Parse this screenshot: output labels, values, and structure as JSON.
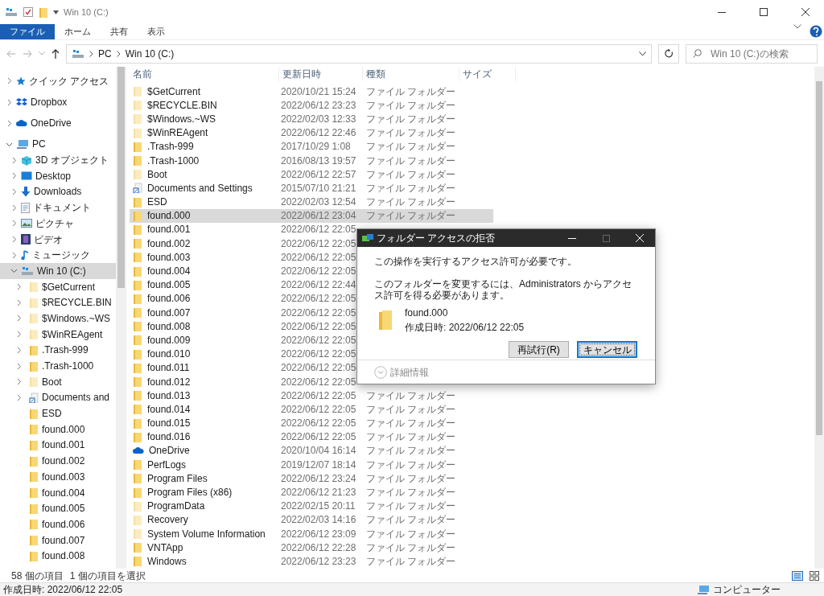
{
  "window": {
    "title": "Win 10 (C:)"
  },
  "ribbon_tabs": [
    {
      "label": "ファイル",
      "selected": true
    },
    {
      "label": "ホーム",
      "selected": false
    },
    {
      "label": "共有",
      "selected": false
    },
    {
      "label": "表示",
      "selected": false
    }
  ],
  "address_bar": {
    "path": [
      "PC",
      "Win 10 (C:)"
    ]
  },
  "search": {
    "placeholder": "Win 10 (C:)の検索"
  },
  "sidebar": {
    "items": [
      {
        "label": "クイック アクセス",
        "kind": "star",
        "expanded": false,
        "selected": false
      },
      {
        "label": "Dropbox",
        "kind": "dropbox",
        "expanded": false,
        "selected": false
      },
      {
        "label": "OneDrive",
        "kind": "cloud",
        "expanded": false,
        "selected": false
      },
      {
        "label": "PC",
        "kind": "pc",
        "expanded": true,
        "selected": false,
        "children": [
          {
            "label": "3D オブジェクト",
            "kind": "cube",
            "expanded": false,
            "selected": false
          },
          {
            "label": "Desktop",
            "kind": "desktop",
            "expanded": false,
            "selected": false
          },
          {
            "label": "Downloads",
            "kind": "download",
            "expanded": false,
            "selected": false
          },
          {
            "label": "ドキュメント",
            "kind": "document",
            "expanded": false,
            "selected": false
          },
          {
            "label": "ピクチャ",
            "kind": "picture",
            "expanded": false,
            "selected": false
          },
          {
            "label": "ビデオ",
            "kind": "video",
            "expanded": false,
            "selected": false
          },
          {
            "label": "ミュージック",
            "kind": "music",
            "expanded": false,
            "selected": false
          },
          {
            "label": "Win 10 (C:)",
            "kind": "drive",
            "expanded": true,
            "selected": true,
            "children": [
              {
                "label": "$GetCurrent",
                "kind": "folder",
                "hidden": true,
                "expanded": false,
                "selected": false
              },
              {
                "label": "$RECYCLE.BIN",
                "kind": "folder",
                "hidden": true,
                "expanded": false,
                "selected": false
              },
              {
                "label": "$Windows.~WS",
                "kind": "folder",
                "hidden": true,
                "expanded": false,
                "selected": false
              },
              {
                "label": "$WinREAgent",
                "kind": "folder",
                "hidden": true,
                "expanded": false,
                "selected": false
              },
              {
                "label": ".Trash-999",
                "kind": "folder",
                "hidden": false,
                "expanded": false,
                "selected": false
              },
              {
                "label": ".Trash-1000",
                "kind": "folder",
                "hidden": false,
                "expanded": false,
                "selected": false
              },
              {
                "label": "Boot",
                "kind": "folder",
                "hidden": true,
                "expanded": false,
                "selected": false
              },
              {
                "label": "Documents and",
                "kind": "shortcut",
                "hidden": false,
                "expanded": false,
                "selected": false
              },
              {
                "label": "ESD",
                "kind": "folder",
                "hidden": false,
                "selected": false
              },
              {
                "label": "found.000",
                "kind": "folder",
                "hidden": false,
                "selected": false
              },
              {
                "label": "found.001",
                "kind": "folder",
                "hidden": false,
                "selected": false
              },
              {
                "label": "found.002",
                "kind": "folder",
                "hidden": false,
                "selected": false
              },
              {
                "label": "found.003",
                "kind": "folder",
                "hidden": false,
                "selected": false
              },
              {
                "label": "found.004",
                "kind": "folder",
                "hidden": false,
                "selected": false
              },
              {
                "label": "found.005",
                "kind": "folder",
                "hidden": false,
                "selected": false
              },
              {
                "label": "found.006",
                "kind": "folder",
                "hidden": false,
                "selected": false
              },
              {
                "label": "found.007",
                "kind": "folder",
                "hidden": false,
                "selected": false
              },
              {
                "label": "found.008",
                "kind": "folder",
                "hidden": false,
                "selected": false
              }
            ]
          }
        ]
      }
    ]
  },
  "file_list": {
    "columns": [
      "名前",
      "更新日時",
      "種類",
      "サイズ"
    ],
    "rows": [
      {
        "name": "$GetCurrent",
        "date": "2020/10/21 15:24",
        "type": "ファイル フォルダー",
        "kind": "folder",
        "hidden": true,
        "selected": false
      },
      {
        "name": "$RECYCLE.BIN",
        "date": "2022/06/12 23:23",
        "type": "ファイル フォルダー",
        "kind": "folder",
        "hidden": true,
        "selected": false
      },
      {
        "name": "$Windows.~WS",
        "date": "2022/02/03 12:33",
        "type": "ファイル フォルダー",
        "kind": "folder",
        "hidden": true,
        "selected": false
      },
      {
        "name": "$WinREAgent",
        "date": "2022/06/12 22:46",
        "type": "ファイル フォルダー",
        "kind": "folder",
        "hidden": true,
        "selected": false
      },
      {
        "name": ".Trash-999",
        "date": "2017/10/29 1:08",
        "type": "ファイル フォルダー",
        "kind": "folder",
        "hidden": false,
        "selected": false
      },
      {
        "name": ".Trash-1000",
        "date": "2016/08/13 19:57",
        "type": "ファイル フォルダー",
        "kind": "folder",
        "hidden": false,
        "selected": false
      },
      {
        "name": "Boot",
        "date": "2022/06/12 22:57",
        "type": "ファイル フォルダー",
        "kind": "folder",
        "hidden": true,
        "selected": false
      },
      {
        "name": "Documents and Settings",
        "date": "2015/07/10 21:21",
        "type": "ファイル フォルダー",
        "kind": "shortcut",
        "hidden": false,
        "selected": false
      },
      {
        "name": "ESD",
        "date": "2022/02/03 12:54",
        "type": "ファイル フォルダー",
        "kind": "folder",
        "hidden": false,
        "selected": false
      },
      {
        "name": "found.000",
        "date": "2022/06/12 23:04",
        "type": "ファイル フォルダー",
        "kind": "folder",
        "hidden": false,
        "selected": true
      },
      {
        "name": "found.001",
        "date": "2022/06/12 22:05",
        "kind": "folder",
        "hidden": false,
        "selected": false
      },
      {
        "name": "found.002",
        "date": "2022/06/12 22:05",
        "kind": "folder",
        "hidden": false,
        "selected": false
      },
      {
        "name": "found.003",
        "date": "2022/06/12 22:05",
        "kind": "folder",
        "hidden": false,
        "selected": false
      },
      {
        "name": "found.004",
        "date": "2022/06/12 22:05",
        "kind": "folder",
        "hidden": false,
        "selected": false
      },
      {
        "name": "found.005",
        "date": "2022/06/12 22:44",
        "kind": "folder",
        "hidden": false,
        "selected": false
      },
      {
        "name": "found.006",
        "date": "2022/06/12 22:05",
        "kind": "folder",
        "hidden": false,
        "selected": false
      },
      {
        "name": "found.007",
        "date": "2022/06/12 22:05",
        "kind": "folder",
        "hidden": false,
        "selected": false
      },
      {
        "name": "found.008",
        "date": "2022/06/12 22:05",
        "kind": "folder",
        "hidden": false,
        "selected": false
      },
      {
        "name": "found.009",
        "date": "2022/06/12 22:05",
        "kind": "folder",
        "hidden": false,
        "selected": false
      },
      {
        "name": "found.010",
        "date": "2022/06/12 22:05",
        "kind": "folder",
        "hidden": false,
        "selected": false
      },
      {
        "name": "found.011",
        "date": "2022/06/12 22:05",
        "kind": "folder",
        "hidden": false,
        "selected": false
      },
      {
        "name": "found.012",
        "date": "2022/06/12 22:05",
        "kind": "folder",
        "hidden": false,
        "selected": false
      },
      {
        "name": "found.013",
        "date": "2022/06/12 22:05",
        "type": "ファイル フォルダー",
        "kind": "folder",
        "hidden": false,
        "selected": false
      },
      {
        "name": "found.014",
        "date": "2022/06/12 22:05",
        "type": "ファイル フォルダー",
        "kind": "folder",
        "hidden": false,
        "selected": false
      },
      {
        "name": "found.015",
        "date": "2022/06/12 22:05",
        "type": "ファイル フォルダー",
        "kind": "folder",
        "hidden": false,
        "selected": false
      },
      {
        "name": "found.016",
        "date": "2022/06/12 22:05",
        "type": "ファイル フォルダー",
        "kind": "folder",
        "hidden": false,
        "selected": false
      },
      {
        "name": "OneDrive",
        "date": "2020/10/04 16:14",
        "type": "ファイル フォルダー",
        "kind": "cloud",
        "hidden": false,
        "selected": false
      },
      {
        "name": "PerfLogs",
        "date": "2019/12/07 18:14",
        "type": "ファイル フォルダー",
        "kind": "folder",
        "hidden": false,
        "selected": false
      },
      {
        "name": "Program Files",
        "date": "2022/06/12 23:24",
        "type": "ファイル フォルダー",
        "kind": "folder",
        "hidden": false,
        "selected": false
      },
      {
        "name": "Program Files (x86)",
        "date": "2022/06/12 21:23",
        "type": "ファイル フォルダー",
        "kind": "folder",
        "hidden": false,
        "selected": false
      },
      {
        "name": "ProgramData",
        "date": "2022/02/15 20:11",
        "type": "ファイル フォルダー",
        "kind": "folder",
        "hidden": true,
        "selected": false
      },
      {
        "name": "Recovery",
        "date": "2022/02/03 14:16",
        "type": "ファイル フォルダー",
        "kind": "folder",
        "hidden": true,
        "selected": false
      },
      {
        "name": "System Volume Information",
        "date": "2022/06/12 23:09",
        "type": "ファイル フォルダー",
        "kind": "folder",
        "hidden": true,
        "selected": false
      },
      {
        "name": "VNTApp",
        "date": "2022/06/12 22:28",
        "type": "ファイル フォルダー",
        "kind": "folder",
        "hidden": false,
        "selected": false
      },
      {
        "name": "Windows",
        "date": "2022/06/12 23:23",
        "type": "ファイル フォルダー",
        "kind": "folder",
        "hidden": false,
        "selected": false
      }
    ]
  },
  "status_bar": {
    "item_count": "58 個の項目",
    "selection": "1 個の項目を選択"
  },
  "details_bar": {
    "created": "作成日時: 2022/06/12 22:05",
    "location": "コンピューター"
  },
  "dialog": {
    "title": "フォルダー アクセスの拒否",
    "message": "この操作を実行するアクセス許可が必要です。",
    "detail": "このフォルダーを変更するには、Administrators からアクセス許可を得る必要があります。",
    "item_name": "found.000",
    "item_created": "作成日時: 2022/06/12 22:05",
    "buttons": [
      {
        "label": "再試行(R)",
        "focused": false
      },
      {
        "label": "キャンセル",
        "focused": true
      }
    ],
    "more_info": "詳細情報"
  }
}
